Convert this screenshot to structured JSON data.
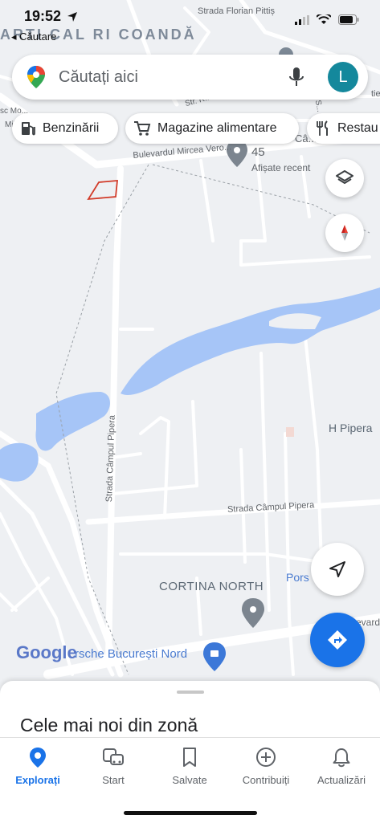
{
  "status_bar": {
    "time": "19:52",
    "back_label": "◂ Căutare",
    "area_name": "ARTI CAL  RI COANDĂ"
  },
  "search": {
    "placeholder": "Căutați aici",
    "avatar_letter": "L"
  },
  "chips": [
    {
      "label": "Benzinării",
      "icon": "gas-station-icon"
    },
    {
      "label": "Magazine alimentare",
      "icon": "cart-icon"
    },
    {
      "label": "Restau",
      "icon": "restaurant-icon"
    }
  ],
  "map": {
    "labels": {
      "florian_pittis": "Strada Florian Pittiș",
      "bulevard": "Bulevardul Mircea Vero...",
      "str_r": "Str. R...",
      "mos": "sc Mo...",
      "mill": "Milla...",
      "strada_s": "Strada S...",
      "ca": "Câ...",
      "tie": "tie",
      "campul_pipera_vertical": "Strada Câmpul Pipera",
      "campul_pipera": "Strada Câmpul Pipera",
      "evard": "evard",
      "h_pipera": "H Pipera",
      "porsche_short": "Pors",
      "porsche_bucuresti": "rsche București Nord",
      "cortina": "CORTINA NORTH",
      "place_count": "45",
      "afisate_recent": "Afișate recent",
      "google": "Google"
    }
  },
  "bottom_sheet": {
    "title": "Cele mai noi din zonă"
  },
  "nav": [
    {
      "label": "Explorați",
      "icon": "location-pin-icon",
      "active": true
    },
    {
      "label": "Start",
      "icon": "commute-icon",
      "active": false
    },
    {
      "label": "Salvate",
      "icon": "bookmark-icon",
      "active": false
    },
    {
      "label": "Contribuiți",
      "icon": "add-circle-icon",
      "active": false
    },
    {
      "label": "Actualizări",
      "icon": "bell-icon",
      "active": false
    }
  ],
  "colors": {
    "water": "#a6c5f7",
    "accent": "#1a73e8",
    "avatar": "#14889c",
    "directions": "#1a73e8"
  }
}
